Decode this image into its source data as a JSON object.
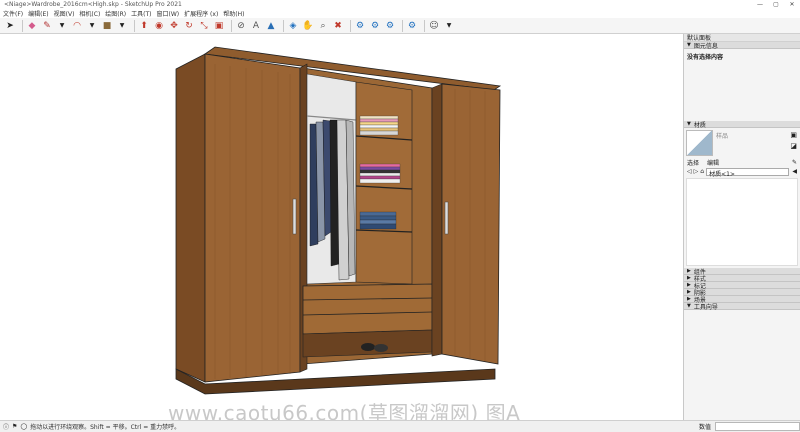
{
  "app": {
    "title": "<Niage>Wardrobe_2016cm<High.skp - SketchUp Pro 2021"
  },
  "menu": [
    "文件(F)",
    "编辑(E)",
    "视图(V)",
    "相机(C)",
    "绘图(R)",
    "工具(T)",
    "窗口(W)",
    "扩展程序 (x)",
    "帮助(H)"
  ],
  "panel": {
    "title": "默认面板",
    "entity_info": {
      "title": "图元信息",
      "empty_text": "没有选择内容"
    },
    "materials": {
      "title": "材质",
      "placeholder": "样品",
      "tabs": {
        "select": "选择",
        "edit": "编辑"
      },
      "material_name": "材质<1>"
    },
    "collapsed": [
      "组件",
      "样式",
      "标记",
      "阴影",
      "场景",
      "工具向导"
    ]
  },
  "status": {
    "text": "拖动以进行环绕观察。Shift = 平移。Ctrl = 重力禁呼。",
    "measure_label": "数值"
  },
  "watermark": "www.caotu66.com(草图溜溜网) 图A",
  "colors": {
    "wood": "#8b5a2f",
    "wood_dark": "#6a4221",
    "wood_light": "#a56e3c",
    "accent": "#1e6fbf"
  }
}
